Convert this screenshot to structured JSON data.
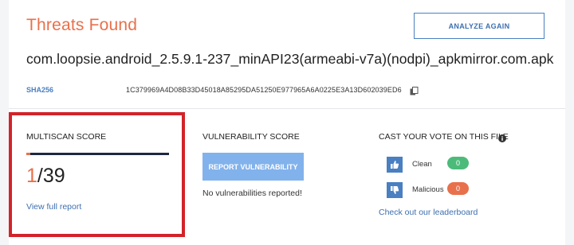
{
  "header": {
    "title": "Threats Found",
    "analyze_button": "ANALYZE AGAIN",
    "filename": "com.loopsie.android_2.5.9.1-237_minAPI23(armeabi-v7a)(nodpi)_apkmirror.com.apk",
    "sha_label": "SHA256",
    "sha_value": "1C379969A4D08B33D45018A85295DA51250E977965A6A0225E3A13D602039ED6",
    "copy_icon": "copy-icon"
  },
  "multiscan": {
    "heading": "MULTISCAN SCORE",
    "detected": "1",
    "total": "/39",
    "detected_fraction": 0.0256,
    "link": "View full report"
  },
  "vulnerability": {
    "heading": "VULNERABILITY SCORE",
    "button": "REPORT VULNERABILITY",
    "status": "No vulnerabilities reported!"
  },
  "vote": {
    "heading": "CAST YOUR VOTE ON THIS FILE",
    "info_icon": "info-icon",
    "options": [
      {
        "label": "Clean",
        "count": "0",
        "color": "#4cbb7a",
        "icon": "thumbs-up-icon"
      },
      {
        "label": "Malicious",
        "count": "0",
        "color": "#e8704b",
        "icon": "thumbs-down-icon"
      }
    ],
    "leaderboard_link": "Check out our leaderboard"
  },
  "colors": {
    "accent_orange": "#e8704b",
    "link_blue": "#3d6fb0",
    "highlight_red": "#d2232a"
  }
}
